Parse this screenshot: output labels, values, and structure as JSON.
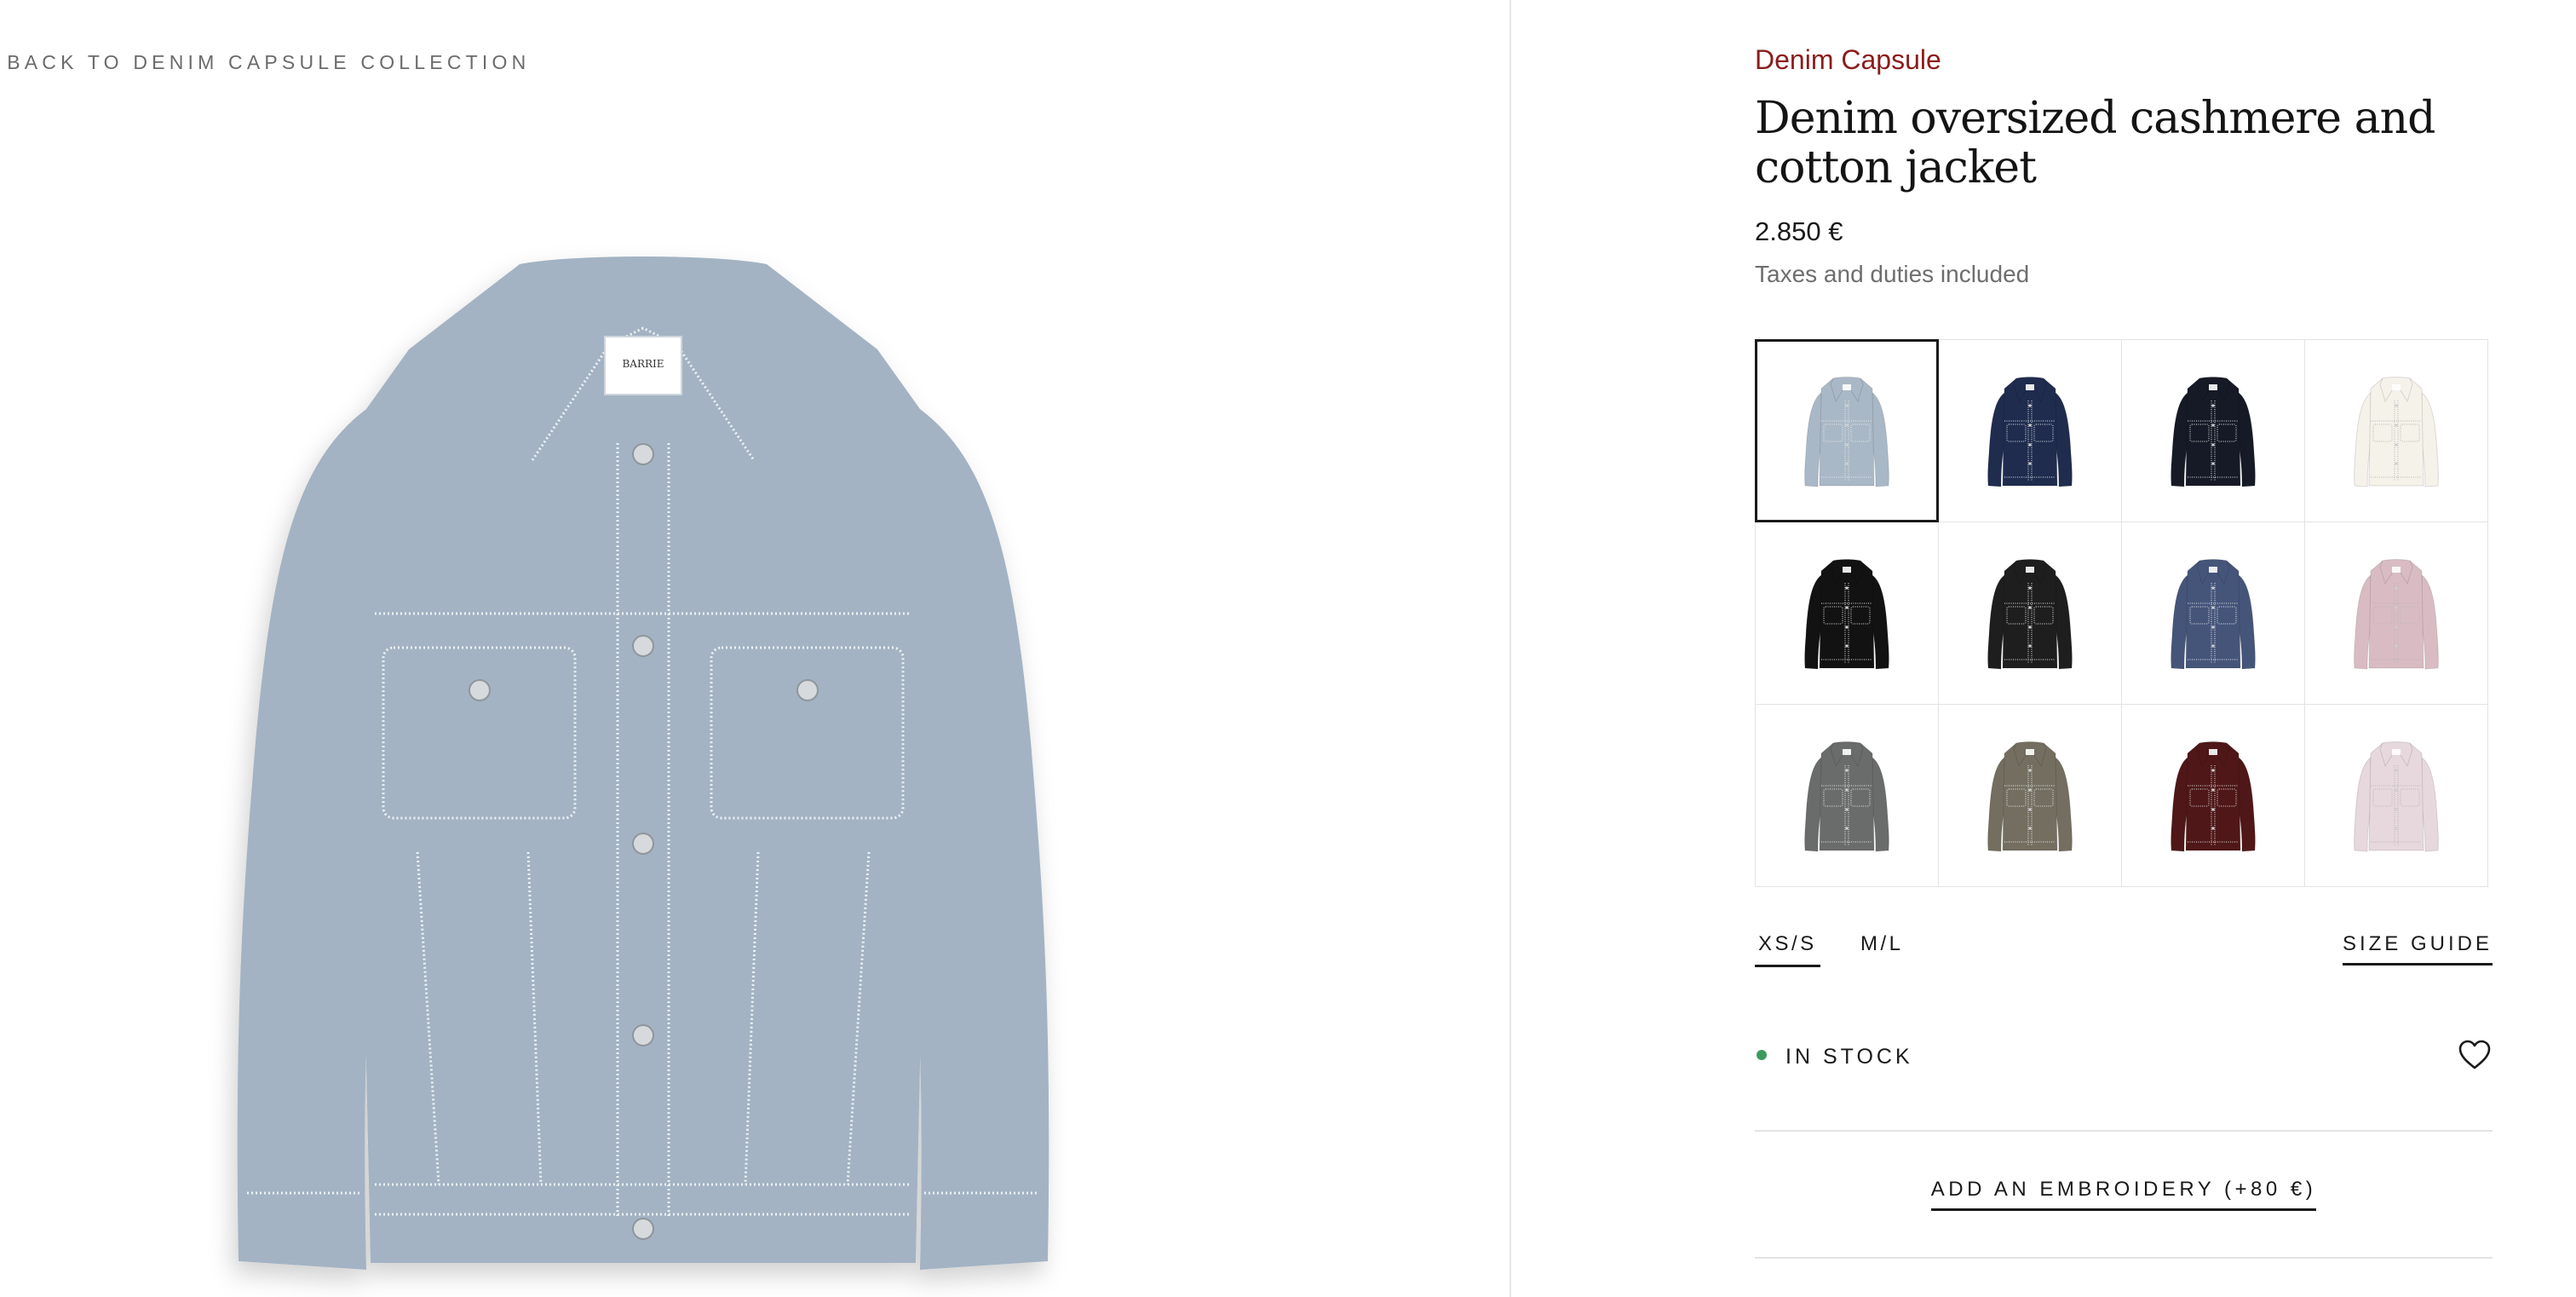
{
  "nav": {
    "back_link": "< BACK TO DENIM CAPSULE COLLECTION"
  },
  "product": {
    "collection": "Denim Capsule",
    "title": "Denim oversized cashmere and cotton jacket",
    "price": "2.850 €",
    "taxes_note": "Taxes and duties included",
    "hero_label": "BARRIE",
    "hero_color": "#a3b3c3",
    "variants": [
      {
        "color": "#a9b8c6",
        "selected": true
      },
      {
        "color": "#1f2c4e",
        "selected": false
      },
      {
        "color": "#161a26",
        "selected": false
      },
      {
        "color": "#f5f2ea",
        "selected": false
      },
      {
        "color": "#121212",
        "selected": false
      },
      {
        "color": "#1e1e1e",
        "selected": false
      },
      {
        "color": "#45557a",
        "selected": false
      },
      {
        "color": "#d9bcc3",
        "selected": false
      },
      {
        "color": "#6a6c6b",
        "selected": false
      },
      {
        "color": "#746e60",
        "selected": false
      },
      {
        "color": "#4f1717",
        "selected": false
      },
      {
        "color": "#e7d8de",
        "selected": false
      }
    ]
  },
  "sizes": {
    "options": [
      "XS/S",
      "M/L"
    ],
    "selected": "XS/S",
    "guide_label": "SIZE GUIDE"
  },
  "stock": {
    "label": "IN STOCK",
    "dot_color": "#3c9a5f"
  },
  "actions": {
    "embroidery_label": "ADD AN EMBROIDERY (+80 €)",
    "wishlist_icon": "heart-outline-icon"
  },
  "colors": {
    "accent": "#8b1c1c",
    "text": "#1a1a1a",
    "muted": "#6e6e6e",
    "border": "#e4e4e4"
  }
}
